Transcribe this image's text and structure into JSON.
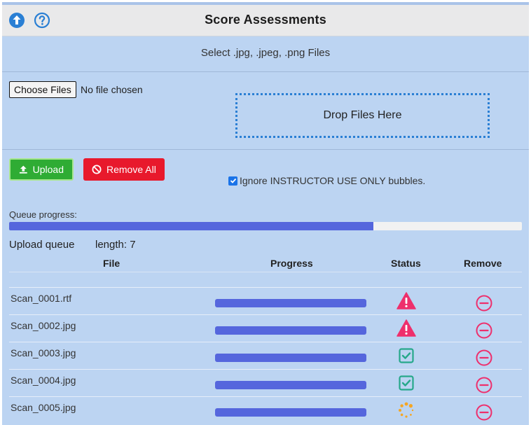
{
  "titlebar": {
    "title": "Score Assessments",
    "icons": [
      "arrow-up-circle-icon",
      "help-circle-icon"
    ],
    "icon_color": "#2a7fd4"
  },
  "subtitle": "Select .jpg, .jpeg, .png Files",
  "file_input": {
    "button_label": "Choose Files",
    "status": "No file chosen"
  },
  "dropzone": {
    "label": "Drop Files Here"
  },
  "buttons": {
    "upload": "Upload",
    "remove_all": "Remove All"
  },
  "ignore_option": {
    "checked": true,
    "label": "Ignore INSTRUCTOR USE ONLY bubbles."
  },
  "queue": {
    "progress_label": "Queue progress:",
    "progress_percent": 71,
    "title": "Upload queue",
    "length_text": "length: 7"
  },
  "table": {
    "columns": [
      "File",
      "Progress",
      "Status",
      "Remove"
    ],
    "rows": [
      {
        "file": "Scan_0001.rtf",
        "progress": 100,
        "status": "warning-icon"
      },
      {
        "file": "Scan_0002.jpg",
        "progress": 100,
        "status": "warning-icon"
      },
      {
        "file": "Scan_0003.jpg",
        "progress": 100,
        "status": "check-square-icon"
      },
      {
        "file": "Scan_0004.jpg",
        "progress": 100,
        "status": "check-square-icon"
      },
      {
        "file": "Scan_0005.jpg",
        "progress": 100,
        "status": "spinner-icon"
      }
    ]
  },
  "colors": {
    "background": "#bcd4f2",
    "upload": "#2fac34",
    "remove_all": "#e8192c",
    "progress": "#5566dd",
    "warning": "#ee2f6c",
    "success": "#26a88a",
    "spinner": "#f5a623",
    "remove": "#ee2f6c"
  }
}
